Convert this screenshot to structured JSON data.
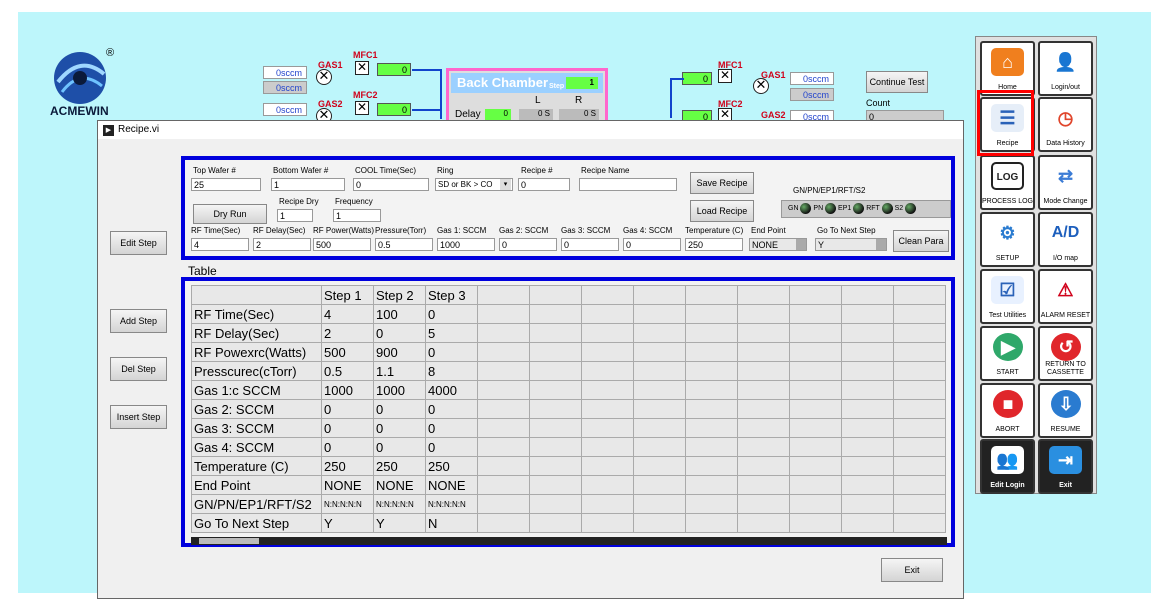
{
  "brand": {
    "name": "ACMEWIN",
    "reg": "®"
  },
  "background": {
    "sccm_left": [
      "0sccm",
      "0sccm",
      "0sccm"
    ],
    "sccm_right": [
      "0sccm",
      "0sccm",
      "0sccm"
    ],
    "gas1": "GAS1",
    "gas2": "GAS2",
    "mfc1": "MFC1",
    "mfc2": "MFC2",
    "mfc_values": [
      "0",
      "0",
      "0",
      "0"
    ],
    "back_chamber": {
      "title": "Back Chamber",
      "step_label": "Step",
      "step_value": "1",
      "col_l": "L",
      "col_r": "R",
      "delay_label": "Delay",
      "delay_value": "0",
      "l_value": "0 S",
      "r_value": "0 S"
    },
    "continue_test": "Continue Test",
    "count_label": "Count",
    "count_value": "0"
  },
  "nav": {
    "home": "Home",
    "login": "Login/out",
    "recipe": "Recipe",
    "data_history": "Data History",
    "process_log": "PROCESS LOG",
    "mode_change": "Mode Change",
    "setup": "SETUP",
    "io_map": "I/O map",
    "test_utilities": "Test Utilities",
    "alarm_reset": "ALARM RESET",
    "start": "START",
    "return_to_cassette": "RETURN TO CASSETTE",
    "abort": "ABORT",
    "resume": "RESUME",
    "edit_login": "Edit Login",
    "exit": "Exit",
    "ad": "A/D",
    "log_badge": "LOG"
  },
  "window": {
    "title": "Recipe.vi"
  },
  "params": {
    "top_wafer_label": "Top Wafer #",
    "top_wafer": "25",
    "bottom_wafer_label": "Bottom Wafer #",
    "bottom_wafer": "1",
    "cool_time_label": "COOL Time(Sec)",
    "cool_time": "0",
    "ring_label": "Ring",
    "ring": "SD or BK > CO",
    "recipe_no_label": "Recipe #",
    "recipe_no": "0",
    "recipe_name_label": "Recipe Name",
    "recipe_name": "",
    "save_recipe": "Save Recipe",
    "load_recipe": "Load Recipe",
    "dry_run": "Dry Run",
    "recipe_dry_label": "Recipe Dry",
    "recipe_dry": "1",
    "frequency_label": "Frequency",
    "frequency": "1",
    "gn_label": "GN/PN/EP1/RFT/S2",
    "leds": [
      "GN",
      "PN",
      "EP1",
      "RFT",
      "S2"
    ],
    "rf_time_label": "RF Time(Sec)",
    "rf_time": "4",
    "rf_delay_label": "RF Delay(Sec)",
    "rf_delay": "2",
    "rf_power_label": "RF Power(Watts)",
    "rf_power": "500",
    "pressure_label": "Pressure(Torr)",
    "pressure": "0.5",
    "gas1_label": "Gas 1: SCCM",
    "gas1": "1000",
    "gas2_label": "Gas 2: SCCM",
    "gas2": "0",
    "gas3_label": "Gas 3: SCCM",
    "gas3": "0",
    "gas4_label": "Gas 4: SCCM",
    "gas4": "0",
    "temp_label": "Temperature (C)",
    "temp": "250",
    "end_point_label": "End Point",
    "end_point": "NONE",
    "next_step_label": "Go To Next Step",
    "next_step": "Y",
    "clean_para": "Clean Para"
  },
  "side_buttons": {
    "edit": "Edit Step",
    "add": "Add Step",
    "del": "Del Step",
    "insert": "Insert Step"
  },
  "table": {
    "label": "Table",
    "headers": [
      "Step 1",
      "Step 2",
      "Step 3"
    ],
    "rows": [
      {
        "name": "RF Time(Sec)",
        "v": [
          "4",
          "100",
          "0"
        ]
      },
      {
        "name": "RF Delay(Sec)",
        "v": [
          "2",
          "0",
          "5"
        ]
      },
      {
        "name": "RF Powexrc(Watts)",
        "v": [
          "500",
          "900",
          "0"
        ]
      },
      {
        "name": "Presscurec(cTorr)",
        "v": [
          "0.5",
          "1.1",
          "8"
        ]
      },
      {
        "name": "Gas 1:c SCCM",
        "v": [
          "1000",
          "1000",
          "4000"
        ]
      },
      {
        "name": "Gas 2: SCCM",
        "v": [
          "0",
          "0",
          "0"
        ]
      },
      {
        "name": "Gas 3: SCCM",
        "v": [
          "0",
          "0",
          "0"
        ]
      },
      {
        "name": "Gas 4: SCCM",
        "v": [
          "0",
          "0",
          "0"
        ]
      },
      {
        "name": "Temperature (C)",
        "v": [
          "250",
          "250",
          "250"
        ]
      },
      {
        "name": "End Point",
        "v": [
          "NONE",
          "NONE",
          "NONE"
        ]
      },
      {
        "name": "GN/PN/EP1/RFT/S2",
        "v": [
          "N:N:N:N:N",
          "N:N:N:N:N",
          "N:N:N:N:N"
        ]
      },
      {
        "name": "Go To Next Step",
        "v": [
          "Y",
          "Y",
          "N"
        ]
      }
    ]
  },
  "exit_button": "Exit",
  "colors": {
    "accent_blue": "#0000dd",
    "highlight_red": "#ff0000",
    "arrow_yellow": "#ffe600",
    "background_cyan": "#bdf6fb"
  }
}
